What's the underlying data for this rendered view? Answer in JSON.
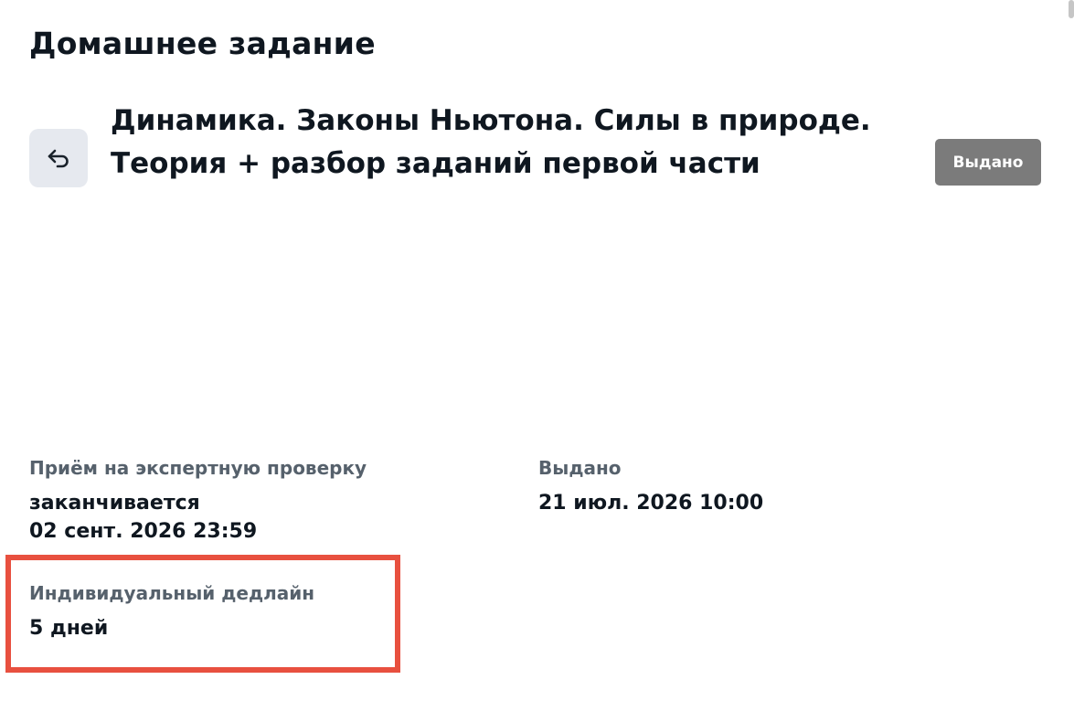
{
  "page": {
    "title": "Домашнее задание"
  },
  "homework": {
    "lesson_title": "Динамика. Законы Ньютона. Силы в природе. Теория + разбор заданий первой части",
    "status": "Выдано",
    "back_icon": "undo-arrow-icon"
  },
  "review": {
    "label": "Приём на экспертную проверку",
    "value_line1": "заканчивается",
    "value_line2": "02 сент. 2026 23:59"
  },
  "issued": {
    "label": "Выдано",
    "value": "21 июл. 2026 10:00"
  },
  "deadline": {
    "label": "Индивидуальный дедлайн",
    "value": "5 дней",
    "highlight_color": "#e8503f"
  }
}
